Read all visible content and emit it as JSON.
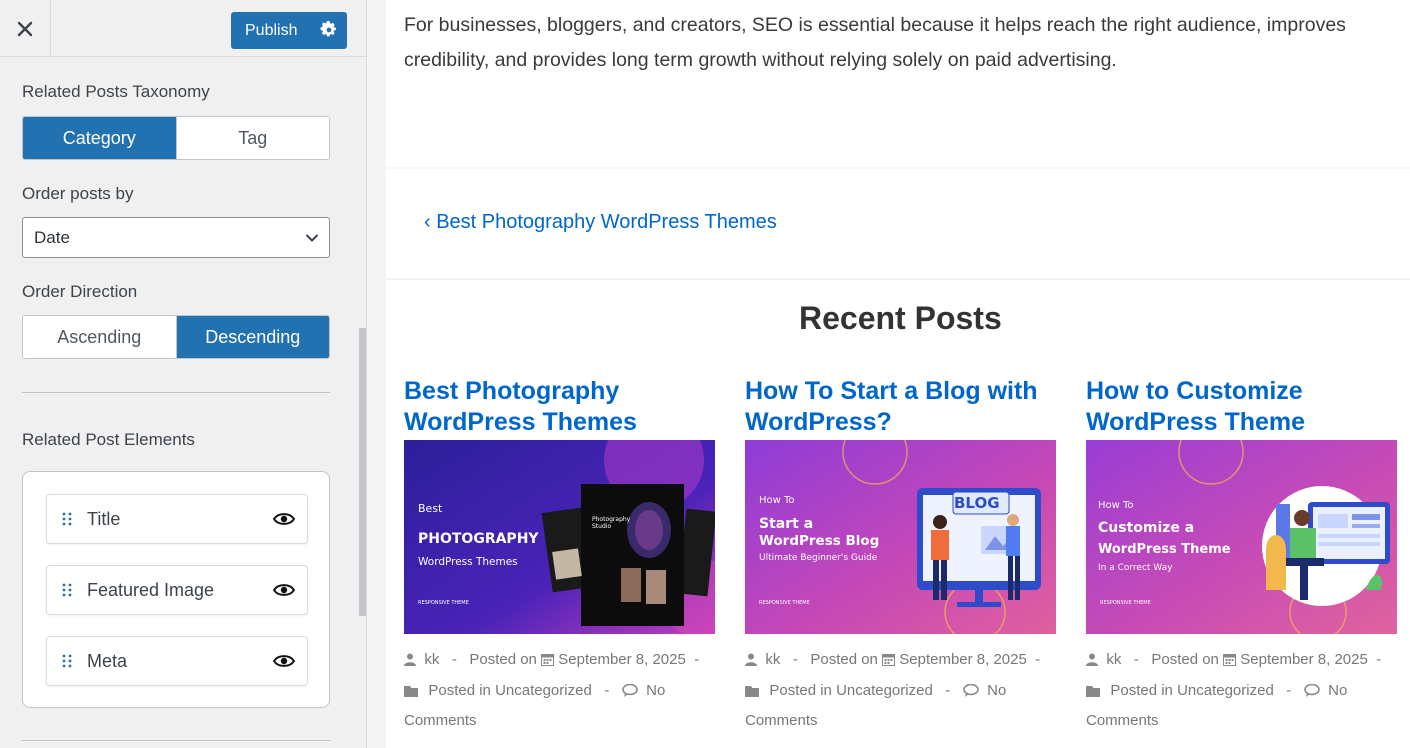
{
  "panel": {
    "close_label": "✕",
    "publish_label": "Publish",
    "taxonomy": {
      "label": "Related Posts Taxonomy",
      "options": [
        "Category",
        "Tag"
      ],
      "selected": "Category"
    },
    "order_by": {
      "label": "Order posts by",
      "value": "Date"
    },
    "direction": {
      "label": "Order Direction",
      "options": [
        "Ascending",
        "Descending"
      ],
      "selected": "Descending"
    },
    "elements": {
      "label": "Related Post Elements",
      "items": [
        {
          "label": "Title"
        },
        {
          "label": "Featured Image"
        },
        {
          "label": "Meta"
        }
      ]
    }
  },
  "preview": {
    "intro": "For businesses, bloggers, and creators, SEO is essential because it helps reach the right audience, improves credibility, and provides long term growth without relying solely on paid advertising.",
    "prev_link": "‹ Best Photography WordPress Themes",
    "recent_title": "Recent Posts",
    "posts": [
      {
        "title": "Best Photography WordPress Themes",
        "author": "kk",
        "posted_on_label": "Posted on",
        "date": "September 8, 2025",
        "posted_in_label": "Posted in",
        "category": "Uncategorized",
        "comments": "No Comments",
        "thumb": {
          "line1": "Best",
          "line2": "PHOTOGRAPHY",
          "line3": "WordPress Themes",
          "brand": "RESPONSIVE THEME",
          "side": "Photography Studio",
          "colors": [
            "#2c1f9a",
            "#6a2bd0",
            "#c63cbf"
          ]
        }
      },
      {
        "title": "How To Start a Blog with WordPress?",
        "author": "kk",
        "posted_on_label": "Posted on",
        "date": "September 8, 2025",
        "posted_in_label": "Posted in",
        "category": "Uncategorized",
        "comments": "No Comments",
        "thumb": {
          "line1": "How To",
          "line2": "Start a",
          "line3": "WordPress Blog",
          "line4": "Ultimate Beginner's Guide",
          "brand": "RESPONSIVE THEME",
          "badge": "BLOG",
          "colors": [
            "#9b3dd6",
            "#c447b8",
            "#e0609e"
          ]
        }
      },
      {
        "title": "How to Customize WordPress Theme",
        "author": "kk",
        "posted_on_label": "Posted on",
        "date": "September 8, 2025",
        "posted_in_label": "Posted in",
        "category": "Uncategorized",
        "comments": "No Comments",
        "thumb": {
          "line1": "How To",
          "line2": "Customize a",
          "line3": "WordPress Theme",
          "line4": "In a Correct Way",
          "brand": "RESPONSIVE THEME",
          "colors": [
            "#a53fd4",
            "#c74bb6",
            "#e0639d"
          ]
        }
      }
    ]
  },
  "colors": {
    "accent": "#2271b1",
    "link": "#0066cc"
  }
}
